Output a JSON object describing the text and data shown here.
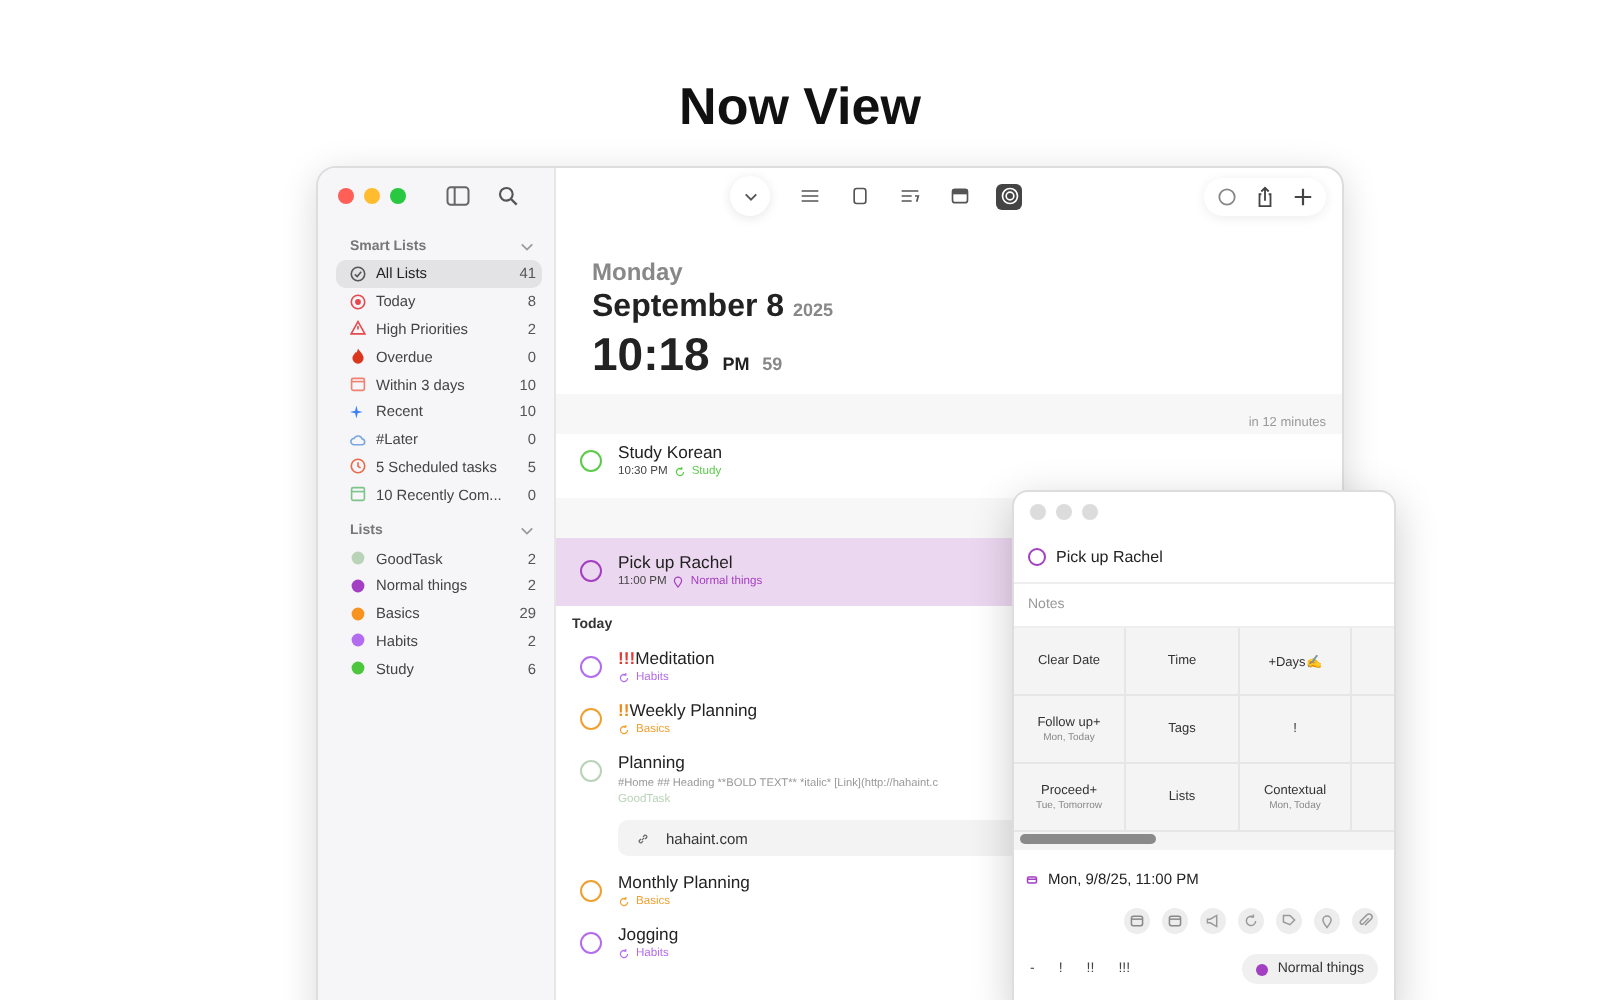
{
  "page_title": "Now View",
  "toolbar": {
    "view_modes": [
      {
        "selected": false
      },
      {
        "selected": false
      },
      {
        "selected": false
      },
      {
        "selected": false
      },
      {
        "selected": true
      }
    ]
  },
  "sidebar": {
    "sections": [
      {
        "title": "Smart Lists",
        "items": [
          {
            "label": "All Lists",
            "count": "41",
            "selected": true
          },
          {
            "label": "Today",
            "count": "8",
            "selected": false
          },
          {
            "label": "High Priorities",
            "count": "2",
            "selected": false
          },
          {
            "label": "Overdue",
            "count": "0",
            "selected": false
          },
          {
            "label": "Within 3 days",
            "count": "10",
            "selected": false
          },
          {
            "label": "Recent",
            "count": "10",
            "selected": false
          },
          {
            "label": "#Later",
            "count": "0",
            "selected": false
          },
          {
            "label": "5 Scheduled tasks",
            "count": "5",
            "selected": false
          },
          {
            "label": "10 Recently Com...",
            "count": "0",
            "selected": false
          }
        ]
      },
      {
        "title": "Lists",
        "items": [
          {
            "color": "#b9d3b8",
            "label": "GoodTask",
            "count": "2",
            "selected": false
          },
          {
            "color": "#a23fc2",
            "label": "Normal things",
            "count": "2",
            "selected": false
          },
          {
            "color": "#f7931e",
            "label": "Basics",
            "count": "29",
            "selected": false
          },
          {
            "color": "#b36cf0",
            "label": "Habits",
            "count": "2",
            "selected": false
          },
          {
            "color": "#4cc63c",
            "label": "Study",
            "count": "6",
            "selected": false
          }
        ]
      }
    ]
  },
  "header": {
    "weekday": "Monday",
    "date": "September 8",
    "year": "2025",
    "time": "10:18",
    "ampm": "PM",
    "seconds": "59"
  },
  "rows": [
    {
      "kind": "gap",
      "label": "in 12 minutes"
    },
    {
      "kind": "task",
      "title": "Study Korean",
      "color": "#5ccb4a",
      "time": "10:30 PM",
      "repeating": true,
      "has_location": false,
      "list": "Study",
      "selected": false
    },
    {
      "kind": "gap"
    },
    {
      "kind": "task",
      "title": "Pick up Rachel",
      "color": "#a23fc2",
      "time": "11:00 PM",
      "repeating": false,
      "has_location": true,
      "list": "Normal things",
      "selected": true
    },
    {
      "kind": "section",
      "label": "Today"
    },
    {
      "kind": "task",
      "priority": {
        "text": "!!!",
        "kind": "high"
      },
      "title": "Meditation",
      "color": "#b36cf0",
      "repeating": true,
      "has_location": false,
      "list": "Habits",
      "selected": false
    },
    {
      "kind": "task",
      "priority": {
        "text": "!!",
        "kind": "medium"
      },
      "title": "Weekly Planning",
      "color": "#f0a030",
      "repeating": true,
      "has_location": false,
      "list": "Basics",
      "selected": false
    },
    {
      "kind": "task",
      "title": "Planning",
      "color": "#b9d3b8",
      "note": "#Home  ## Heading  **BOLD TEXT**  *italic*  [Link](http://hahaint.c",
      "repeating": false,
      "has_location": false,
      "list": "GoodTask",
      "link": "hahaint.com",
      "selected": false
    },
    {
      "kind": "task",
      "title": "Monthly Planning",
      "color": "#f0a030",
      "repeating": true,
      "has_location": false,
      "list": "Basics",
      "selected": false
    },
    {
      "kind": "task",
      "title": "Jogging",
      "color": "#b36cf0",
      "repeating": true,
      "has_location": false,
      "list": "Habits",
      "selected": false
    }
  ],
  "popup": {
    "title": "Pick up Rachel",
    "color": "#a23fc2",
    "notes_placeholder": "Notes",
    "actions": [
      [
        {
          "label": "Clear Date"
        },
        {
          "label": "Time"
        },
        {
          "label": "+Days✍"
        }
      ],
      [
        {
          "label": "Follow up+",
          "sub": "Mon, Today"
        },
        {
          "label": "Tags"
        },
        {
          "label": "!"
        }
      ],
      [
        {
          "label": "Proceed+",
          "sub": "Tue, Tomorrow"
        },
        {
          "label": "Lists"
        },
        {
          "label": "Contextual",
          "sub": "Mon, Today"
        }
      ]
    ],
    "date": "Mon, 9/8/25, 11:00 PM",
    "priorities": [
      "-",
      "!",
      "!!",
      "!!!"
    ],
    "list": {
      "label": "Normal things",
      "color": "#a23fc2"
    }
  }
}
